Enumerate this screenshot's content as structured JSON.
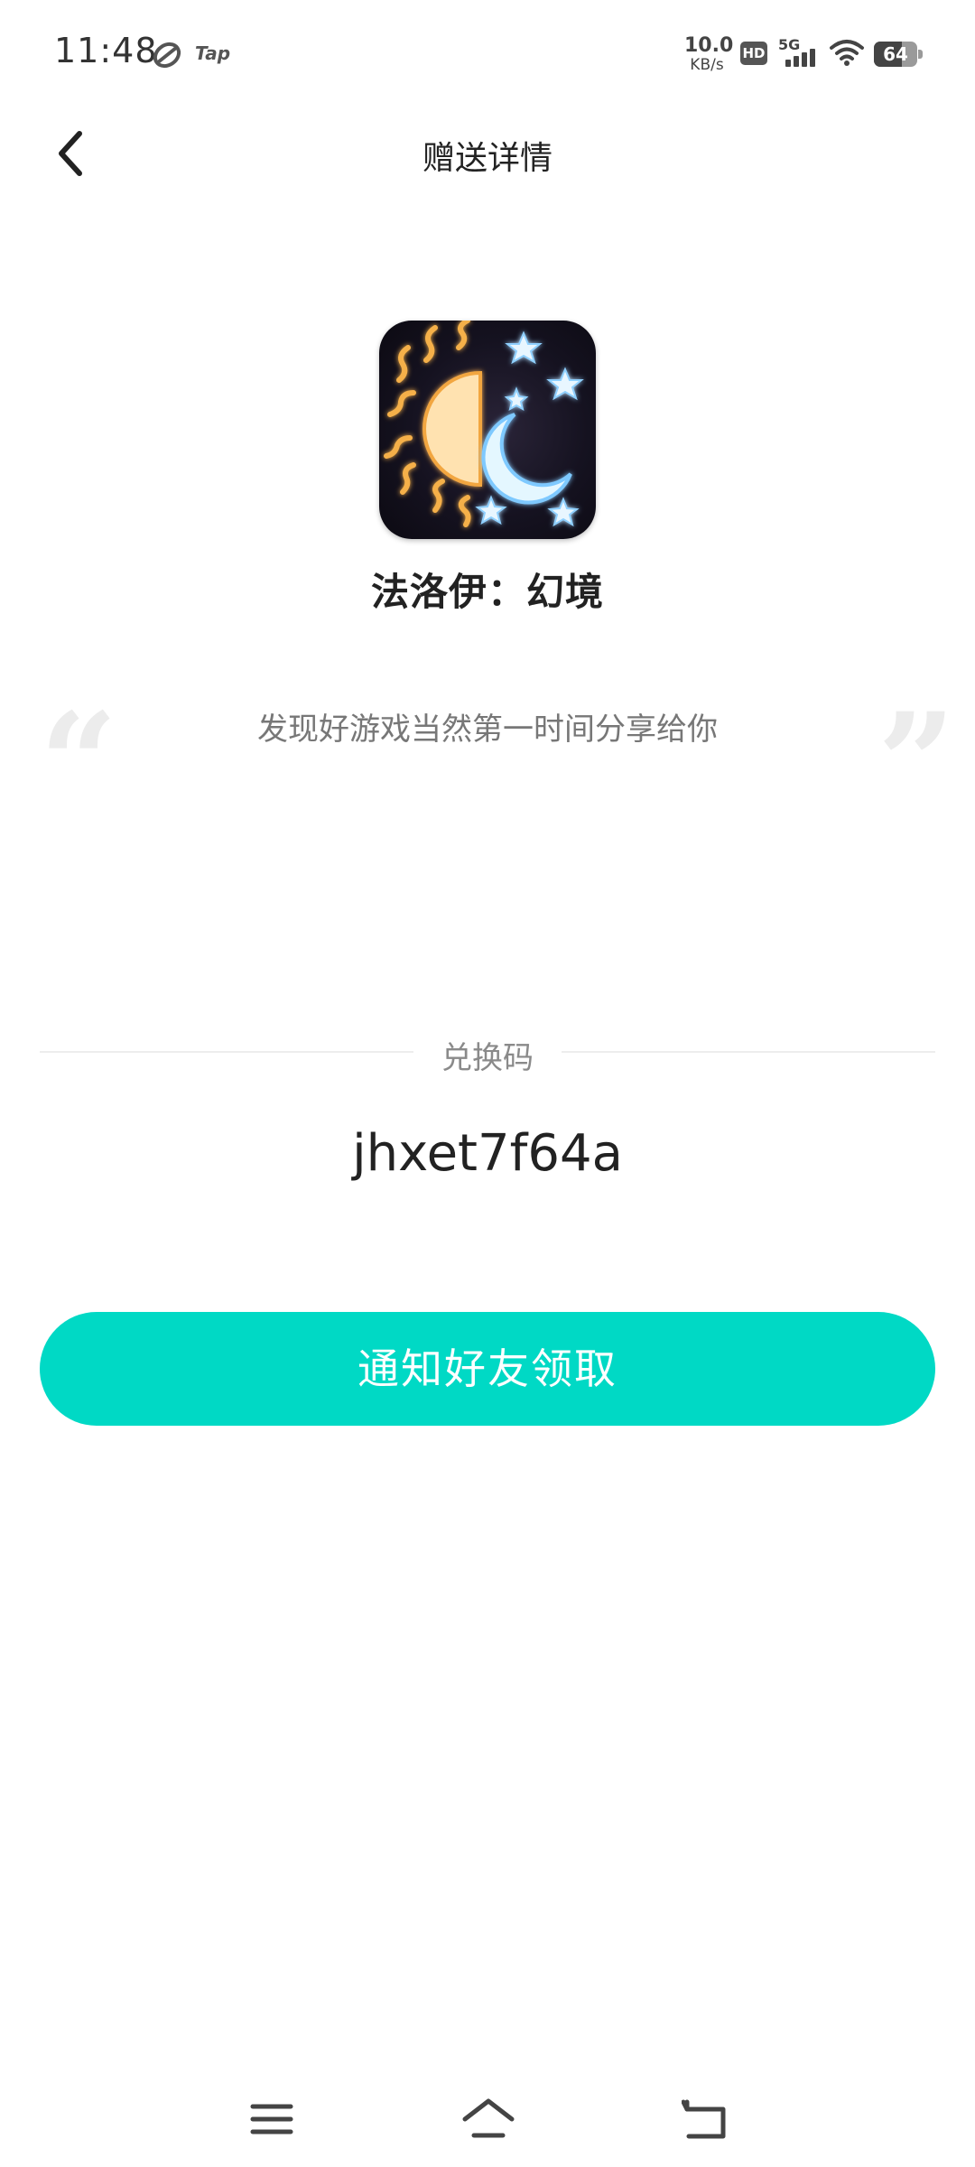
{
  "status_bar": {
    "time": "11:48",
    "app_badge": "Tap",
    "net_speed_value": "10.0",
    "net_speed_unit": "KB/s",
    "hd": "HD",
    "network": "5G",
    "battery": "64",
    "battery_level": 0.64
  },
  "header": {
    "title": "赠送详情",
    "back_icon": "chevron-left-icon"
  },
  "game": {
    "name": "法洛伊：幻境",
    "icon": "sun-moon-icon"
  },
  "share": {
    "message": "发现好游戏当然第一时间分享给你",
    "quote_open": "“",
    "quote_close": "”"
  },
  "redeem": {
    "label": "兑换码",
    "code": "jhxet7f64a"
  },
  "actions": {
    "notify_label": "通知好友领取"
  },
  "nav": {
    "menu_icon": "menu-icon",
    "home_icon": "home-icon",
    "back_icon": "back-arrow-icon"
  },
  "colors": {
    "accent": "#00d9c5",
    "text": "#222222",
    "muted": "#777777"
  }
}
